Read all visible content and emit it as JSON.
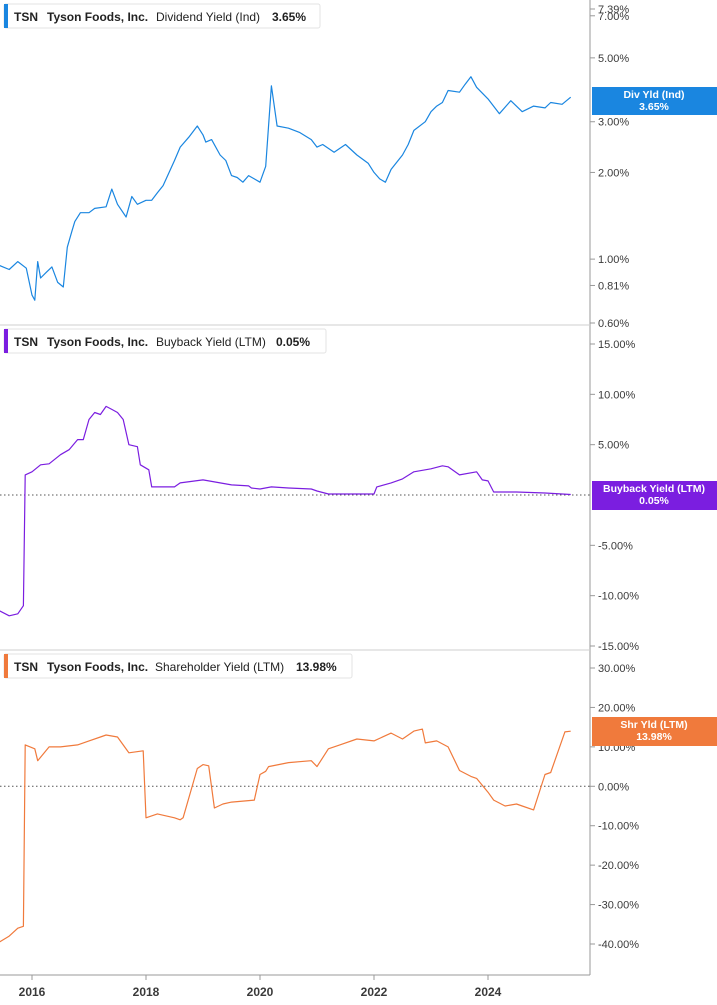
{
  "chart_data": [
    {
      "type": "line",
      "ticker": "TSN",
      "company": "Tyson Foods, Inc.",
      "metric": "Dividend Yield (Ind)",
      "latest": "3.65%",
      "badge": [
        "Div Yld (Ind)",
        "3.65%"
      ],
      "color": "#1a86e0",
      "scale": "log",
      "ylim": [
        0.6,
        7.39
      ],
      "yticks": [
        {
          "v": 7.39,
          "label": "7.39%"
        },
        {
          "v": 7.0,
          "label": "7.00%"
        },
        {
          "v": 5.0,
          "label": "5.00%"
        },
        {
          "v": 3.0,
          "label": "3.00%"
        },
        {
          "v": 2.0,
          "label": "2.00%"
        },
        {
          "v": 1.0,
          "label": "1.00%"
        },
        {
          "v": 0.81,
          "label": "0.81%"
        },
        {
          "v": 0.6,
          "label": "0.60%"
        }
      ],
      "zero_line": false,
      "x": [
        2015.43,
        2015.6,
        2015.75,
        2015.9,
        2016.0,
        2016.05,
        2016.1,
        2016.15,
        2016.25,
        2016.35,
        2016.45,
        2016.55,
        2016.62,
        2016.7,
        2016.75,
        2016.85,
        2017.0,
        2017.1,
        2017.3,
        2017.4,
        2017.5,
        2017.65,
        2017.75,
        2017.85,
        2018.0,
        2018.1,
        2018.2,
        2018.3,
        2018.5,
        2018.6,
        2018.75,
        2018.9,
        2019.0,
        2019.05,
        2019.15,
        2019.3,
        2019.4,
        2019.5,
        2019.6,
        2019.7,
        2019.8,
        2019.9,
        2020.0,
        2020.1,
        2020.17,
        2020.2,
        2020.3,
        2020.5,
        2020.7,
        2020.9,
        2021.0,
        2021.1,
        2021.3,
        2021.5,
        2021.7,
        2021.9,
        2022.0,
        2022.1,
        2022.2,
        2022.3,
        2022.5,
        2022.6,
        2022.7,
        2022.9,
        2023.0,
        2023.1,
        2023.2,
        2023.3,
        2023.5,
        2023.6,
        2023.7,
        2023.8,
        2024.0,
        2024.2,
        2024.4,
        2024.6,
        2024.8,
        2025.0,
        2025.1,
        2025.3,
        2025.45
      ],
      "y": [
        0.95,
        0.92,
        0.98,
        0.93,
        0.75,
        0.72,
        0.98,
        0.86,
        0.9,
        0.94,
        0.83,
        0.8,
        1.1,
        1.25,
        1.35,
        1.45,
        1.45,
        1.5,
        1.52,
        1.75,
        1.55,
        1.4,
        1.65,
        1.55,
        1.6,
        1.6,
        1.7,
        1.8,
        2.2,
        2.45,
        2.65,
        2.9,
        2.7,
        2.55,
        2.6,
        2.3,
        2.2,
        1.95,
        1.92,
        1.85,
        1.95,
        1.9,
        1.85,
        2.1,
        3.3,
        4.0,
        2.9,
        2.85,
        2.75,
        2.6,
        2.45,
        2.5,
        2.35,
        2.5,
        2.3,
        2.15,
        2.0,
        1.9,
        1.85,
        2.05,
        2.3,
        2.5,
        2.8,
        3.0,
        3.25,
        3.4,
        3.5,
        3.85,
        3.8,
        4.05,
        4.3,
        3.95,
        3.6,
        3.2,
        3.55,
        3.25,
        3.4,
        3.35,
        3.5,
        3.45,
        3.65
      ]
    },
    {
      "type": "line",
      "ticker": "TSN",
      "company": "Tyson Foods, Inc.",
      "metric": "Buyback Yield (LTM)",
      "latest": "0.05%",
      "badge": [
        "Buyback Yield (LTM)",
        "0.05%"
      ],
      "color": "#7b1ee0",
      "scale": "linear",
      "ylim": [
        -15,
        15
      ],
      "yticks": [
        {
          "v": 15,
          "label": "15.00%"
        },
        {
          "v": 10,
          "label": "10.00%"
        },
        {
          "v": 5,
          "label": "5.00%"
        },
        {
          "v": -5,
          "label": "-5.00%"
        },
        {
          "v": -10,
          "label": "-10.00%"
        },
        {
          "v": -15,
          "label": "-15.00%"
        }
      ],
      "zero_line": true,
      "x": [
        2015.43,
        2015.6,
        2015.75,
        2015.85,
        2015.88,
        2016.0,
        2016.15,
        2016.3,
        2016.5,
        2016.65,
        2016.8,
        2016.9,
        2017.0,
        2017.1,
        2017.2,
        2017.3,
        2017.4,
        2017.5,
        2017.6,
        2017.7,
        2017.85,
        2017.9,
        2018.05,
        2018.1,
        2018.5,
        2018.6,
        2019.0,
        2019.5,
        2019.8,
        2019.85,
        2020.0,
        2020.2,
        2020.5,
        2020.9,
        2021.0,
        2021.2,
        2021.6,
        2022.0,
        2022.05,
        2022.3,
        2022.5,
        2022.7,
        2023.0,
        2023.2,
        2023.3,
        2023.5,
        2023.8,
        2023.9,
        2024.0,
        2024.1,
        2024.5,
        2025.0,
        2025.45
      ],
      "y": [
        -11.5,
        -12.0,
        -11.8,
        -11.0,
        2.0,
        2.3,
        3.0,
        3.1,
        4.0,
        4.5,
        5.5,
        5.5,
        7.5,
        8.2,
        8.0,
        8.8,
        8.5,
        8.2,
        7.5,
        5.0,
        4.8,
        3.0,
        2.5,
        0.8,
        0.8,
        1.2,
        1.5,
        1.0,
        0.9,
        0.7,
        0.6,
        0.8,
        0.7,
        0.6,
        0.4,
        0.1,
        0.1,
        0.1,
        0.8,
        1.2,
        1.6,
        2.3,
        2.6,
        2.9,
        2.8,
        2.0,
        2.3,
        1.5,
        1.4,
        0.3,
        0.3,
        0.2,
        0.05
      ]
    },
    {
      "type": "line",
      "ticker": "TSN",
      "company": "Tyson Foods, Inc.",
      "metric": "Shareholder Yield (LTM)",
      "latest": "13.98%",
      "badge": [
        "Shr Yld (LTM)",
        "13.98%"
      ],
      "color": "#f07a3c",
      "scale": "linear",
      "ylim": [
        -40,
        30
      ],
      "yticks": [
        {
          "v": 30,
          "label": "30.00%"
        },
        {
          "v": 20,
          "label": "20.00%"
        },
        {
          "v": 10,
          "label": "10.00%"
        },
        {
          "v": 0,
          "label": "0.00%"
        },
        {
          "v": -10,
          "label": "-10.00%"
        },
        {
          "v": -20,
          "label": "-20.00%"
        },
        {
          "v": -30,
          "label": "-30.00%"
        },
        {
          "v": -40,
          "label": "-40.00%"
        }
      ],
      "zero_line": true,
      "x": [
        2015.43,
        2015.6,
        2015.75,
        2015.85,
        2015.88,
        2016.05,
        2016.1,
        2016.3,
        2016.5,
        2016.8,
        2017.0,
        2017.2,
        2017.3,
        2017.5,
        2017.7,
        2017.95,
        2018.0,
        2018.2,
        2018.5,
        2018.6,
        2018.65,
        2018.9,
        2019.0,
        2019.1,
        2019.2,
        2019.35,
        2019.5,
        2019.9,
        2020.0,
        2020.1,
        2020.15,
        2020.5,
        2020.9,
        2021.0,
        2021.2,
        2021.4,
        2021.7,
        2022.0,
        2022.3,
        2022.5,
        2022.7,
        2022.85,
        2022.9,
        2023.1,
        2023.3,
        2023.5,
        2023.7,
        2023.8,
        2024.0,
        2024.1,
        2024.3,
        2024.5,
        2024.6,
        2024.8,
        2025.0,
        2025.1,
        2025.35,
        2025.45
      ],
      "y": [
        -39.5,
        -38.0,
        -36.0,
        -35.5,
        10.5,
        9.5,
        6.5,
        10.0,
        10.0,
        10.5,
        11.5,
        12.5,
        13.0,
        12.5,
        8.5,
        9.0,
        -8.0,
        -7.0,
        -8.0,
        -8.5,
        -8.0,
        4.5,
        5.5,
        5.2,
        -5.5,
        -4.5,
        -4.0,
        -3.5,
        3.0,
        3.8,
        5.0,
        6.0,
        6.5,
        5.0,
        9.5,
        10.5,
        12.0,
        11.5,
        13.5,
        12.0,
        14.0,
        14.5,
        11.0,
        11.5,
        10.0,
        4.0,
        2.5,
        2.0,
        -1.5,
        -3.5,
        -5.0,
        -4.5,
        -5.0,
        -6.0,
        3.0,
        3.5,
        13.8,
        13.98
      ]
    }
  ],
  "x_axis": {
    "labels": [
      "2016",
      "2018",
      "2020",
      "2022",
      "2024"
    ],
    "values": [
      2016,
      2018,
      2020,
      2022,
      2024
    ]
  }
}
